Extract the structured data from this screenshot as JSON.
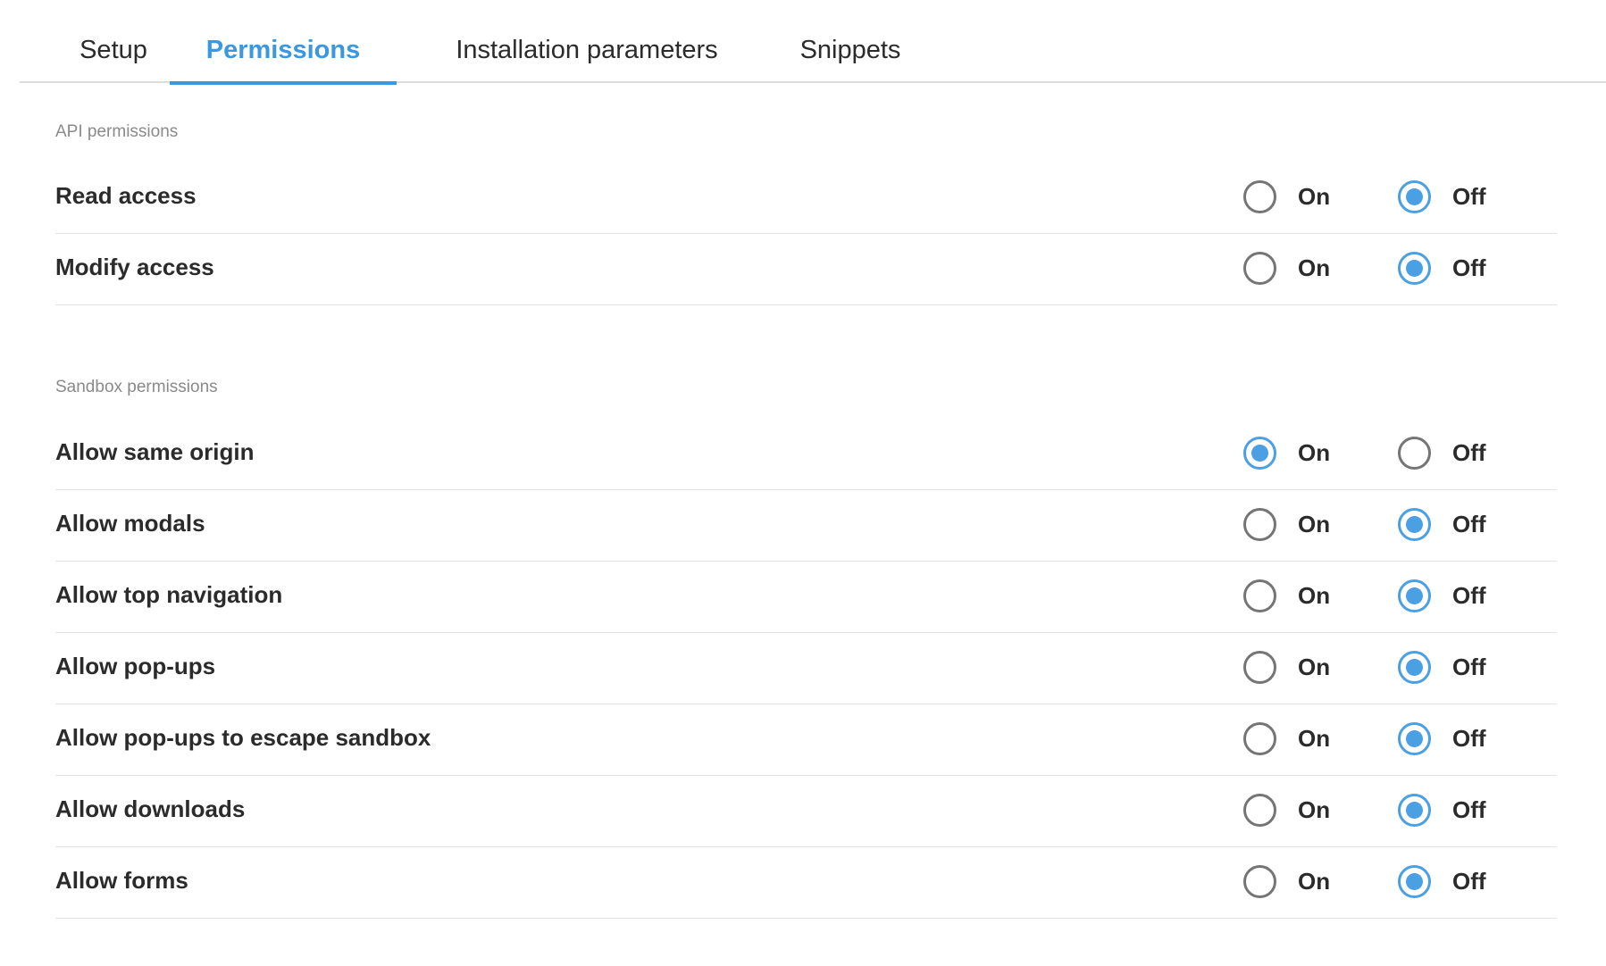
{
  "tabs": [
    {
      "label": "Setup",
      "active": false
    },
    {
      "label": "Permissions",
      "active": true
    },
    {
      "label": "Installation parameters",
      "active": false
    },
    {
      "label": "Snippets",
      "active": false
    }
  ],
  "accent_color": "#3b97e0",
  "radio_labels": {
    "on": "On",
    "off": "Off"
  },
  "sections": [
    {
      "heading": "API permissions",
      "rows": [
        {
          "label": "Read access",
          "value": "off"
        },
        {
          "label": "Modify access",
          "value": "off"
        }
      ]
    },
    {
      "heading": "Sandbox permissions",
      "rows": [
        {
          "label": "Allow same origin",
          "value": "on"
        },
        {
          "label": "Allow modals",
          "value": "off"
        },
        {
          "label": "Allow top navigation",
          "value": "off"
        },
        {
          "label": "Allow pop-ups",
          "value": "off"
        },
        {
          "label": "Allow pop-ups to escape sandbox",
          "value": "off"
        },
        {
          "label": "Allow downloads",
          "value": "off"
        },
        {
          "label": "Allow forms",
          "value": "off"
        }
      ]
    }
  ]
}
